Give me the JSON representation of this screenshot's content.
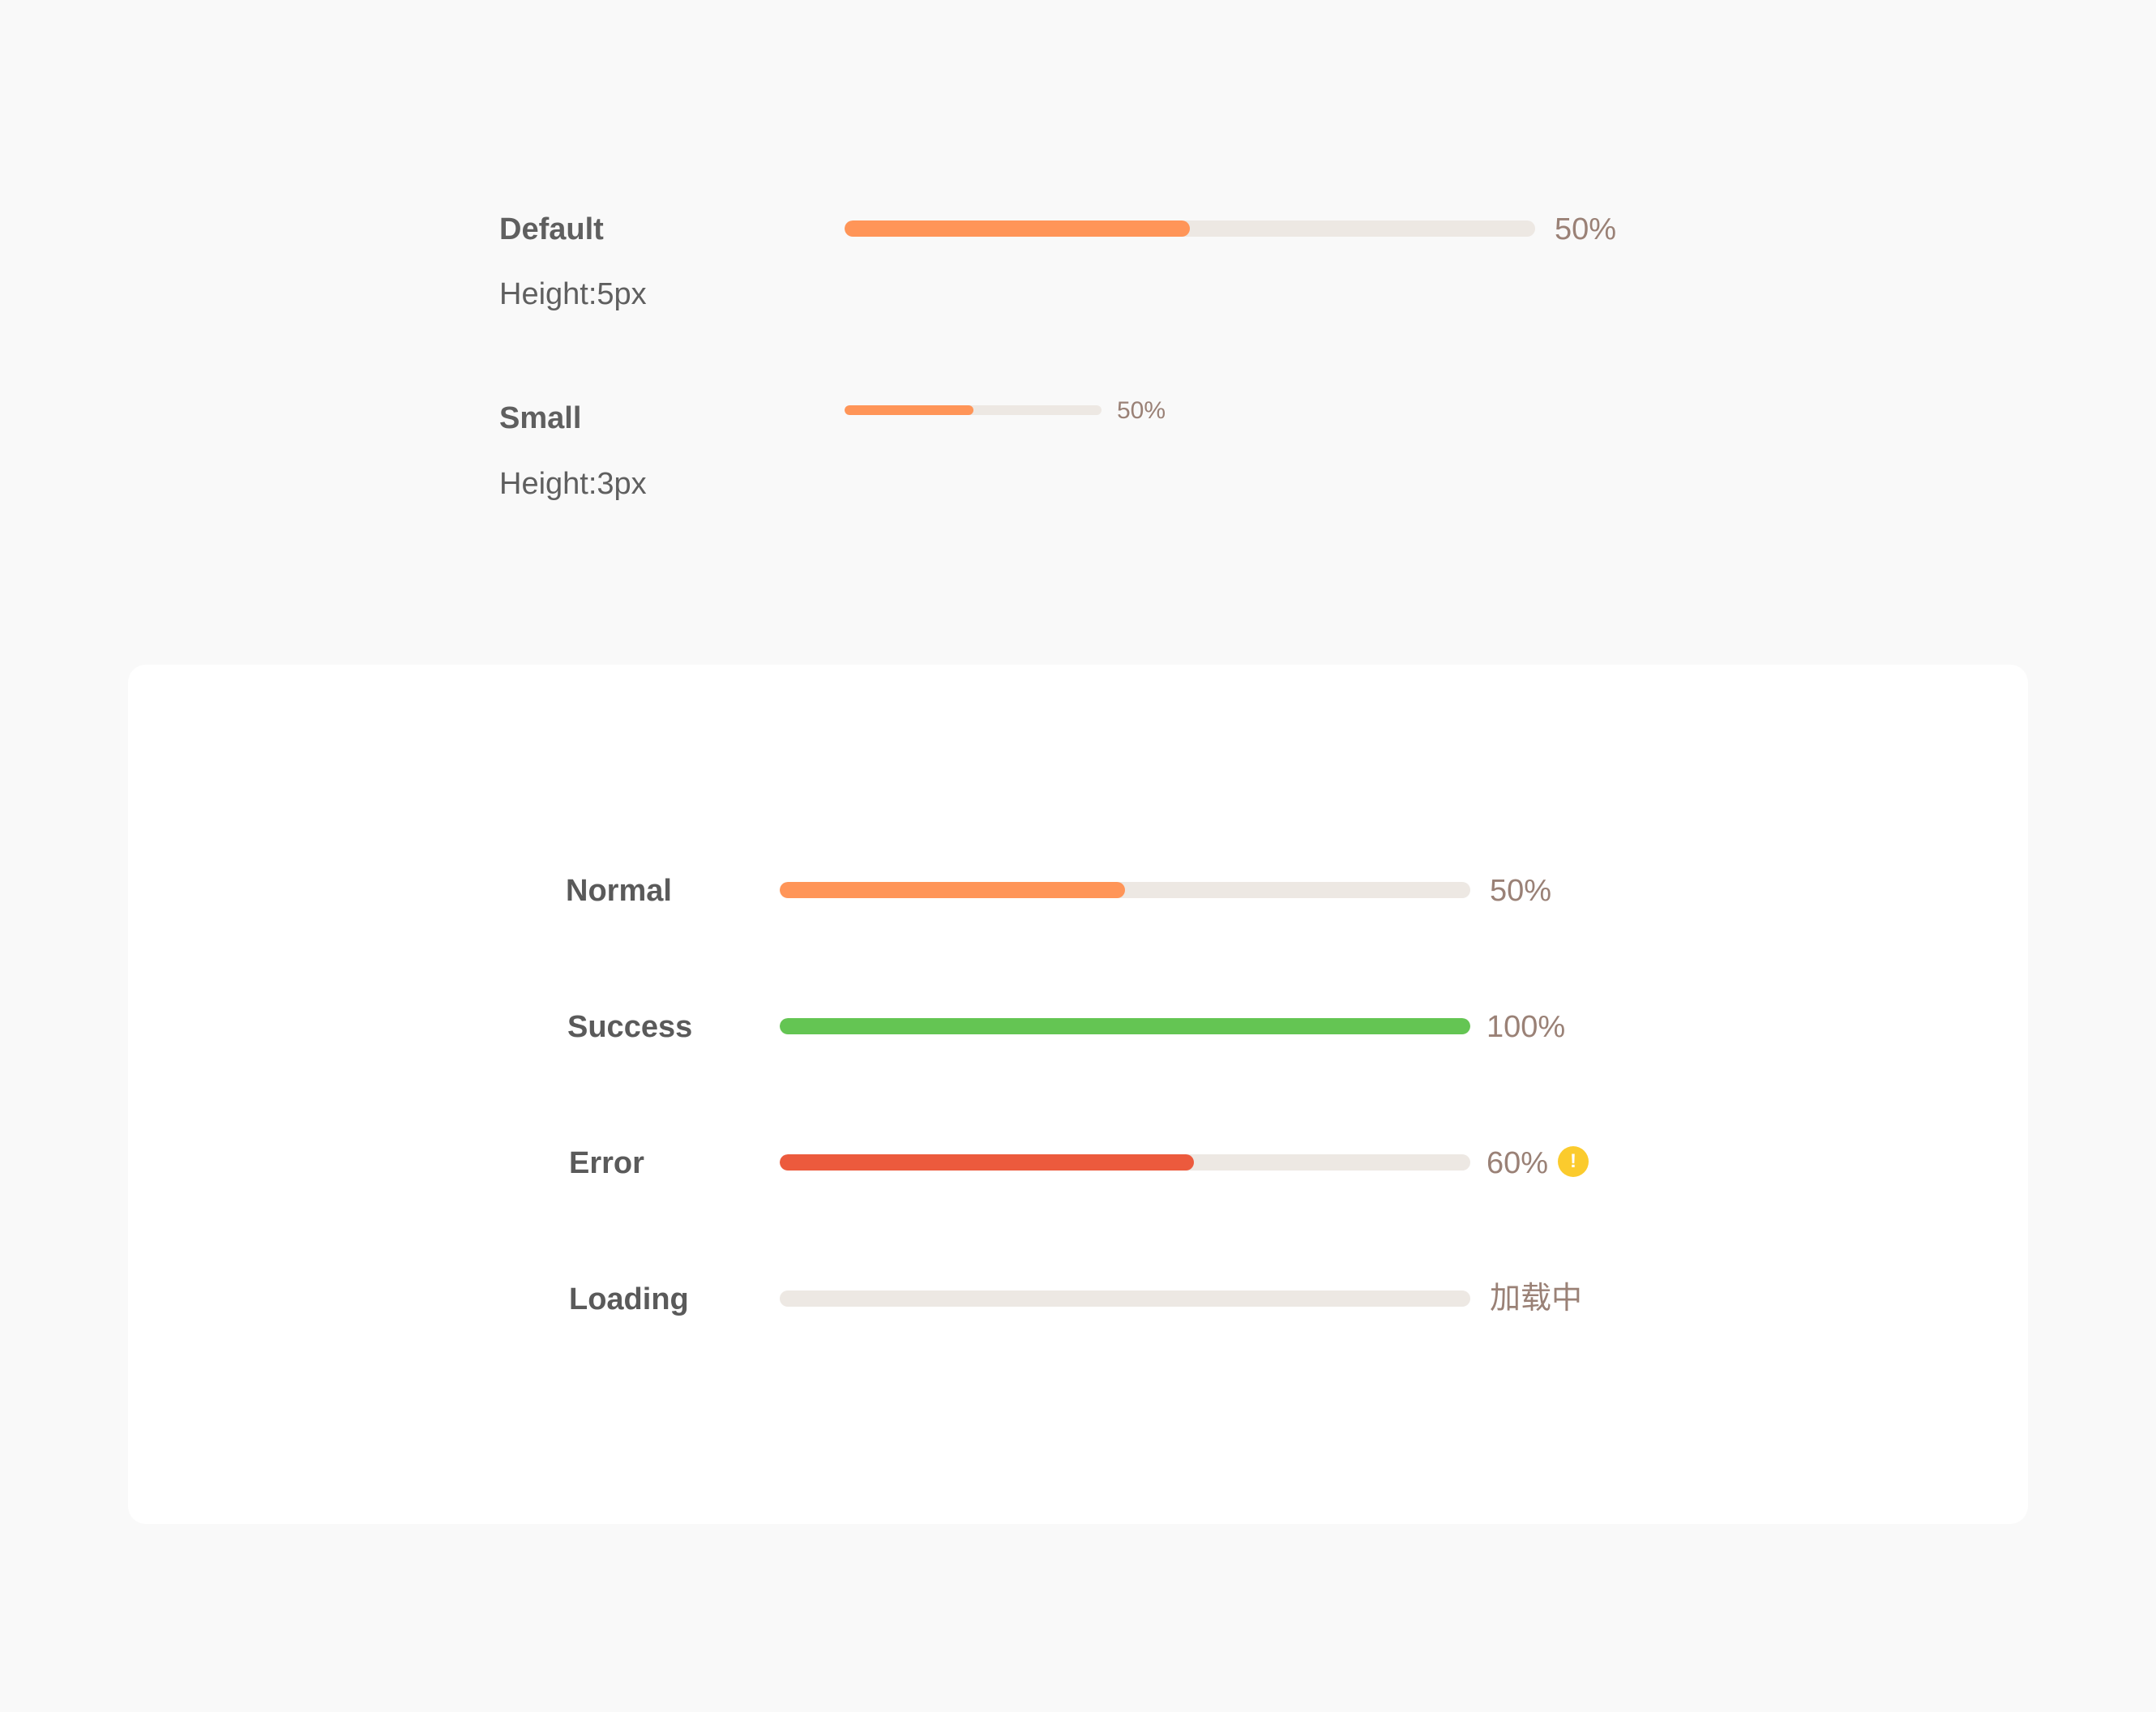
{
  "colors": {
    "track": "#ede8e3",
    "normal": "#ff9558",
    "success": "#64c553",
    "error": "#ec5a3d",
    "warning": "#fbcb2d",
    "percent_text": "#9a8176",
    "label_text": "#5a5a5a"
  },
  "sizes": [
    {
      "title": "Default",
      "height_label": "Height:5px",
      "percent": 50,
      "percent_label": "50%"
    },
    {
      "title": "Small",
      "height_label": "Height:3px",
      "percent": 50,
      "percent_label": "50%"
    }
  ],
  "statuses": [
    {
      "label": "Normal",
      "percent": 50,
      "percent_label": "50%",
      "color": "#ff9558"
    },
    {
      "label": "Success",
      "percent": 100,
      "percent_label": "100%",
      "color": "#64c553"
    },
    {
      "label": "Error",
      "percent": 60,
      "percent_label": "60%",
      "color": "#ec5a3d",
      "icon": "warning-icon",
      "icon_glyph": "!"
    },
    {
      "label": "Loading",
      "percent": 0,
      "percent_label": "加载中",
      "color": "#ff9558"
    }
  ]
}
